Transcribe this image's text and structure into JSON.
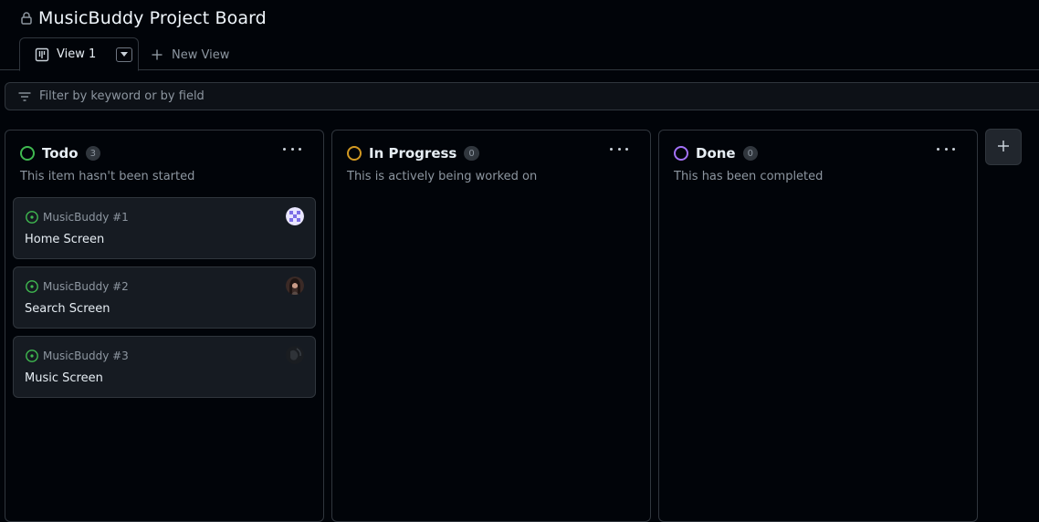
{
  "project": {
    "title": "MusicBuddy Project Board"
  },
  "tabs": {
    "active_label": "View 1",
    "new_view_label": "New View"
  },
  "filter": {
    "placeholder": "Filter by keyword or by field"
  },
  "columns": [
    {
      "name": "Todo",
      "count": "3",
      "description": "This item hasn't been started",
      "color": "#3fb950"
    },
    {
      "name": "In Progress",
      "count": "0",
      "description": "This is actively being worked on",
      "color": "#d29922"
    },
    {
      "name": "Done",
      "count": "0",
      "description": "This has been completed",
      "color": "#a371f7"
    }
  ],
  "cards": [
    {
      "ref": "MusicBuddy #1",
      "title": "Home Screen",
      "avatar": "checker-avatar"
    },
    {
      "ref": "MusicBuddy #2",
      "title": "Search Screen",
      "avatar": "photo-avatar"
    },
    {
      "ref": "MusicBuddy #3",
      "title": "Music Screen",
      "avatar": "dark-avatar"
    }
  ],
  "colors": {
    "background": "#010409",
    "border": "#30363d",
    "card": "#161b22",
    "open_status": "#3fb950",
    "muted_text": "#8d96a0"
  },
  "icons": {
    "lock": "lock-icon",
    "board": "board-icon",
    "plus": "plus-icon",
    "filter": "filter-icon",
    "more": "kebab-horizontal-icon",
    "open_issue": "issue-open-icon"
  }
}
